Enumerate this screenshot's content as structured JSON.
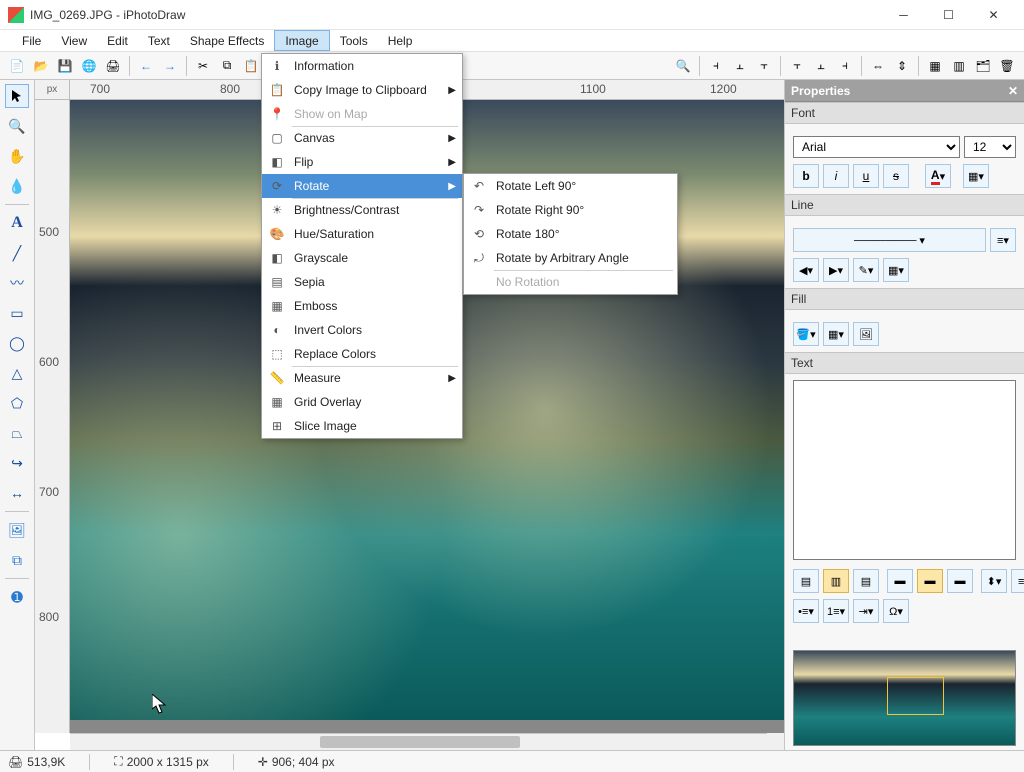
{
  "window": {
    "title": "IMG_0269.JPG - iPhotoDraw"
  },
  "menubar": [
    "File",
    "View",
    "Edit",
    "Text",
    "Shape Effects",
    "Image",
    "Tools",
    "Help"
  ],
  "menubar_active_index": 5,
  "image_menu": {
    "items": [
      {
        "label": "Information",
        "icon": "info",
        "arrow": false
      },
      {
        "label": "Copy Image to Clipboard",
        "icon": "clipboard",
        "arrow": true
      },
      {
        "label": "Show on Map",
        "icon": "pin",
        "arrow": false,
        "disabled": true,
        "sep": true
      },
      {
        "label": "Canvas",
        "icon": "canvas",
        "arrow": true
      },
      {
        "label": "Flip",
        "icon": "flip",
        "arrow": true
      },
      {
        "label": "Rotate",
        "icon": "rotate",
        "arrow": true,
        "hl": true,
        "sep": true
      },
      {
        "label": "Brightness/Contrast",
        "icon": "sun",
        "arrow": false
      },
      {
        "label": "Hue/Saturation",
        "icon": "palette",
        "arrow": false
      },
      {
        "label": "Grayscale",
        "icon": "gray",
        "arrow": false
      },
      {
        "label": "Sepia",
        "icon": "sepia",
        "arrow": false
      },
      {
        "label": "Emboss",
        "icon": "emboss",
        "arrow": false
      },
      {
        "label": "Invert Colors",
        "icon": "invert",
        "arrow": false
      },
      {
        "label": "Replace Colors",
        "icon": "replace",
        "arrow": false,
        "sep": true
      },
      {
        "label": "Measure",
        "icon": "measure",
        "arrow": true
      },
      {
        "label": "Grid Overlay",
        "icon": "grid",
        "arrow": false
      },
      {
        "label": "Slice Image",
        "icon": "slice",
        "arrow": false
      }
    ]
  },
  "rotate_submenu": {
    "items": [
      {
        "label": "Rotate Left 90°",
        "icon": "rot-l"
      },
      {
        "label": "Rotate Right 90°",
        "icon": "rot-r"
      },
      {
        "label": "Rotate 180°",
        "icon": "rot-180"
      },
      {
        "label": "Rotate by Arbitrary Angle",
        "icon": "rot-arb",
        "sep": true
      },
      {
        "label": "No Rotation",
        "disabled": true
      }
    ]
  },
  "properties": {
    "title": "Properties",
    "font": {
      "label": "Font",
      "family": "Arial",
      "size": "12"
    },
    "line": {
      "label": "Line"
    },
    "fill": {
      "label": "Fill"
    },
    "text": {
      "label": "Text",
      "value": ""
    }
  },
  "ruler_unit": "px",
  "ruler_h_ticks": [
    "700",
    "800",
    "1100",
    "1200"
  ],
  "ruler_h_pos": [
    20,
    150,
    510,
    640
  ],
  "ruler_v_ticks": [
    "500",
    "600",
    "700",
    "800"
  ],
  "ruler_v_pos": [
    125,
    255,
    385,
    510
  ],
  "status": {
    "filesize": "513,9K",
    "dims": "2000 x 1315 px",
    "cursor": "906; 404 px"
  }
}
